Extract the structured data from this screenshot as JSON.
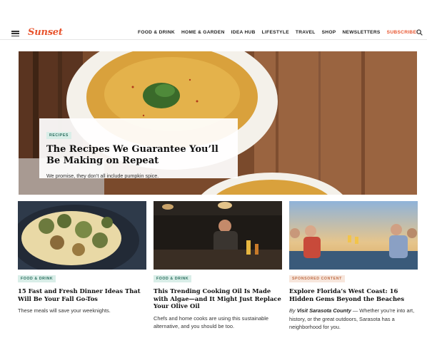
{
  "header": {
    "logo": "Sunset",
    "nav": [
      "FOOD & DRINK",
      "HOME & GARDEN",
      "IDEA HUB",
      "LIFESTYLE",
      "TRAVEL",
      "SHOP",
      "NEWSLETTERS"
    ],
    "subscribe": "SUBSCRIBE!",
    "icons": {
      "menu": "hamburger-menu-icon",
      "search": "search-icon"
    }
  },
  "hero": {
    "tag": "RECIPES",
    "title": "The Recipes We Guarantee You’ll Be Making on Repeat",
    "dek": "We promise, they don’t all include pumpkin spice."
  },
  "cards": [
    {
      "tag": "FOOD & DRINK",
      "title": "15 Fast and Fresh Dinner Ideas That Will Be Your Fall Go-Tos",
      "dek": "These meals will save your weeknights."
    },
    {
      "tag": "FOOD & DRINK",
      "title": "This Trending Cooking Oil Is Made with Algae—and It Might Just Replace Your Olive Oil",
      "dek": "Chefs and home cooks are using this sustainable alternative, and you should be too."
    },
    {
      "tag": "SPONSORED CONTENT",
      "title": "Explore Florida’s West Coast: 16 Hidden Gems Beyond the Beaches",
      "by": "By",
      "sponsor": "Visit Sarasota County",
      "dek": " — Whether you’re into art, history, or the great outdoors, Sarasota has a neighborhood for you."
    }
  ],
  "colors": {
    "brand": "#e8542e",
    "tag_bg": "#d9eee8",
    "tag_text": "#2a6e5e",
    "sponsored_bg": "#f7e6dc",
    "sponsored_text": "#c0704a"
  }
}
